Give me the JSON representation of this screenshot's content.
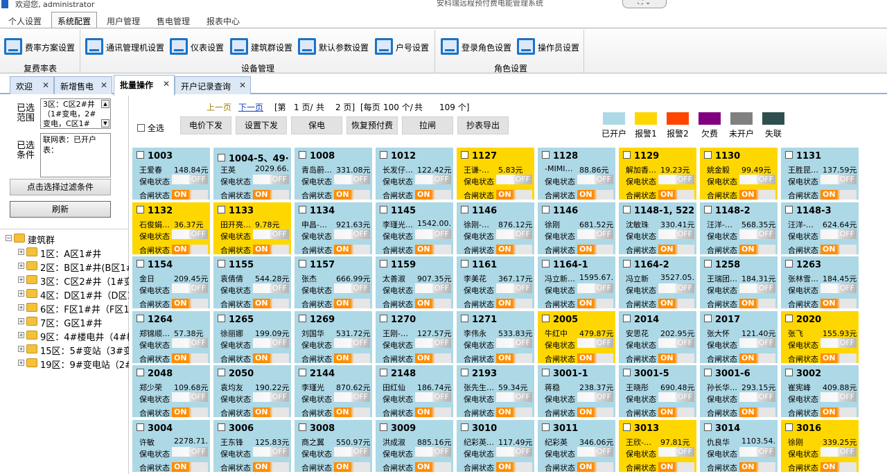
{
  "titlebar": {
    "welcome": "欢迎您, administrator",
    "title": "安科瑞远程预付费电能管理系统",
    "window_controls": "⛶ ⌄"
  },
  "menu_tabs": [
    "个人设置",
    "系统配置",
    "用户管理",
    "售电管理",
    "报表中心"
  ],
  "ribbon": {
    "buttons": [
      "费率方案设置",
      "通讯管理机设置",
      "仪表设置",
      "建筑群设置",
      "默认参数设置",
      "户号设置",
      "登录角色设置",
      "操作员设置"
    ],
    "groups": [
      "复费率表",
      "设备管理",
      "角色设置"
    ]
  },
  "doc_tabs": [
    "欢迎",
    "新增售电",
    "批量操作",
    "开户记录查询"
  ],
  "left": {
    "scope_label": "已选范围",
    "scope_text": "3区：C区2#井（1#变电，2#变电，C区1#",
    "cond_label": "已选条件",
    "cond_text": "联网表：已开户表：",
    "filter_button": "点击选择过滤条件",
    "refresh_button": "刷新"
  },
  "tree": {
    "root": "建筑群",
    "children": [
      "1区：A区1#井",
      "2区：B区1#井(B区1#井",
      "3区：C区2#井（1#变电",
      "4区：D区1#井（D区1#",
      "6区：F区1#井（F区1#",
      "7区：G区1#井",
      "9区：4#楼电井（4#楼",
      "15区：5#变站（3#变电",
      "19区：9#变电站（2#楼"
    ]
  },
  "pager": {
    "prev": "上一页",
    "next": "下一页",
    "page_prefix": "[第",
    "page_current": "1 页/",
    "total_prefix": "共",
    "total_pages": "2 页]",
    "per_page": "[每页",
    "per_page_value": "100 个/",
    "total_label": "共",
    "total_count": "109 个]"
  },
  "select_all": "全选",
  "actions": [
    "电价下发",
    "设置下发",
    "保电",
    "恢复预付费",
    "拉闸",
    "抄表导出"
  ],
  "legend": [
    {
      "label": "已开户",
      "color": "#add8e6"
    },
    {
      "label": "报警1",
      "color": "#ffd700"
    },
    {
      "label": "报警2",
      "color": "#ff4500"
    },
    {
      "label": "欠费",
      "color": "#800080"
    },
    {
      "label": "未开户",
      "color": "#808080"
    },
    {
      "label": "失联",
      "color": "#2f4f4f"
    }
  ],
  "card_labels": {
    "protect": "保电状态",
    "switch": "合闸状态",
    "off": "OFF",
    "on": "ON"
  },
  "cards": [
    {
      "id": "1003",
      "name": "王爱春",
      "balance": "148.84元",
      "warn": false
    },
    {
      "id": "1004-5、49···",
      "name": "王英",
      "balance": "2029.66…",
      "warn": false
    },
    {
      "id": "1008",
      "name": "青岛蔚…",
      "balance": "331.08元",
      "warn": false
    },
    {
      "id": "1012",
      "name": "长发仔…",
      "balance": "122.42元",
      "warn": false
    },
    {
      "id": "1127",
      "name": "王谦-…",
      "balance": "5.83元",
      "warn": true
    },
    {
      "id": "1128",
      "name": "-MIMI…",
      "balance": "88.86元",
      "warn": false
    },
    {
      "id": "1129",
      "name": "解加香…",
      "balance": "19.23元",
      "warn": true
    },
    {
      "id": "1130",
      "name": "姚金毅",
      "balance": "99.49元",
      "warn": true
    },
    {
      "id": "1131",
      "name": "王胜昆…",
      "balance": "137.59元",
      "warn": false
    },
    {
      "id": "1132",
      "name": "石俊娟…",
      "balance": "36.37元",
      "warn": true
    },
    {
      "id": "1133",
      "name": "田开亮…",
      "balance": "9.78元",
      "warn": true
    },
    {
      "id": "1134",
      "name": "申昌-…",
      "balance": "921.63元",
      "warn": false
    },
    {
      "id": "1145",
      "name": "李瑾光…",
      "balance": "1542.00…",
      "warn": false
    },
    {
      "id": "1146",
      "name": "徐刚-…",
      "balance": "876.12元",
      "warn": false
    },
    {
      "id": "1146",
      "name": "徐刚",
      "balance": "681.52元",
      "warn": false
    },
    {
      "id": "1148-1, 522",
      "name": "沈敏珠",
      "balance": "330.41元",
      "warn": false
    },
    {
      "id": "1148-2",
      "name": "汪洋-…",
      "balance": "568.35元",
      "warn": false
    },
    {
      "id": "1148-3",
      "name": "汪洋-…",
      "balance": "624.64元",
      "warn": false
    },
    {
      "id": "1154",
      "name": "金日",
      "balance": "209.45元",
      "warn": false
    },
    {
      "id": "1155",
      "name": "袁倩倩",
      "balance": "544.28元",
      "warn": false
    },
    {
      "id": "1157",
      "name": "张杰",
      "balance": "666.99元",
      "warn": false
    },
    {
      "id": "1159",
      "name": "太善淑",
      "balance": "907.35元",
      "warn": false
    },
    {
      "id": "1161",
      "name": "李美花",
      "balance": "367.17元",
      "warn": false
    },
    {
      "id": "1164-1",
      "name": "冯立新…",
      "balance": "1595.67…",
      "warn": false
    },
    {
      "id": "1164-2",
      "name": "冯立新",
      "balance": "3527.05…",
      "warn": false
    },
    {
      "id": "1258",
      "name": "王瑞团…",
      "balance": "184.31元",
      "warn": false
    },
    {
      "id": "1263",
      "name": "张林雪…",
      "balance": "184.45元",
      "warn": false
    },
    {
      "id": "1264",
      "name": "郑锦顺…",
      "balance": "57.38元",
      "warn": false
    },
    {
      "id": "1265",
      "name": "徐丽娜",
      "balance": "199.09元",
      "warn": false
    },
    {
      "id": "1269",
      "name": "刘国华",
      "balance": "531.72元",
      "warn": false
    },
    {
      "id": "1270",
      "name": "王刚-…",
      "balance": "127.57元",
      "warn": false
    },
    {
      "id": "1271",
      "name": "李伟永",
      "balance": "533.83元",
      "warn": false
    },
    {
      "id": "2005",
      "name": "牛红中",
      "balance": "479.87元",
      "warn": true
    },
    {
      "id": "2014",
      "name": "安思花",
      "balance": "202.95元",
      "warn": false
    },
    {
      "id": "2017",
      "name": "张大怀",
      "balance": "121.40元",
      "warn": false
    },
    {
      "id": "2020",
      "name": "张飞",
      "balance": "155.93元",
      "warn": true
    },
    {
      "id": "2048",
      "name": "郑少荣",
      "balance": "109.68元",
      "warn": false
    },
    {
      "id": "2050",
      "name": "袁均友",
      "balance": "190.22元",
      "warn": false
    },
    {
      "id": "2144",
      "name": "李瑾光",
      "balance": "870.62元",
      "warn": false
    },
    {
      "id": "2148",
      "name": "田红仙",
      "balance": "186.74元",
      "warn": false
    },
    {
      "id": "2193",
      "name": "张先生…",
      "balance": "59.34元",
      "warn": false
    },
    {
      "id": "3001-1",
      "name": "蒋稳",
      "balance": "238.37元",
      "warn": false
    },
    {
      "id": "3001-5",
      "name": "王晓彤",
      "balance": "690.48元",
      "warn": false
    },
    {
      "id": "3001-6",
      "name": "孙长华…",
      "balance": "293.15元",
      "warn": false
    },
    {
      "id": "3002",
      "name": "崔宪峰",
      "balance": "409.88元",
      "warn": false
    },
    {
      "id": "3004",
      "name": "许敏",
      "balance": "2278.71…",
      "warn": false
    },
    {
      "id": "3006",
      "name": "王东锋",
      "balance": "125.83元",
      "warn": false
    },
    {
      "id": "3008",
      "name": "商之翼",
      "balance": "550.97元",
      "warn": false
    },
    {
      "id": "3009",
      "name": "洪成淑",
      "balance": "885.16元",
      "warn": false
    },
    {
      "id": "3010",
      "name": "纪彩英…",
      "balance": "117.49元",
      "warn": false
    },
    {
      "id": "3011",
      "name": "纪彩英",
      "balance": "346.06元",
      "warn": false
    },
    {
      "id": "3013",
      "name": "王欣-…",
      "balance": "97.81元",
      "warn": true
    },
    {
      "id": "3014",
      "name": "仇良华",
      "balance": "1103.54…",
      "warn": false
    },
    {
      "id": "3016",
      "name": "徐刚",
      "balance": "339.25元",
      "warn": true
    }
  ]
}
